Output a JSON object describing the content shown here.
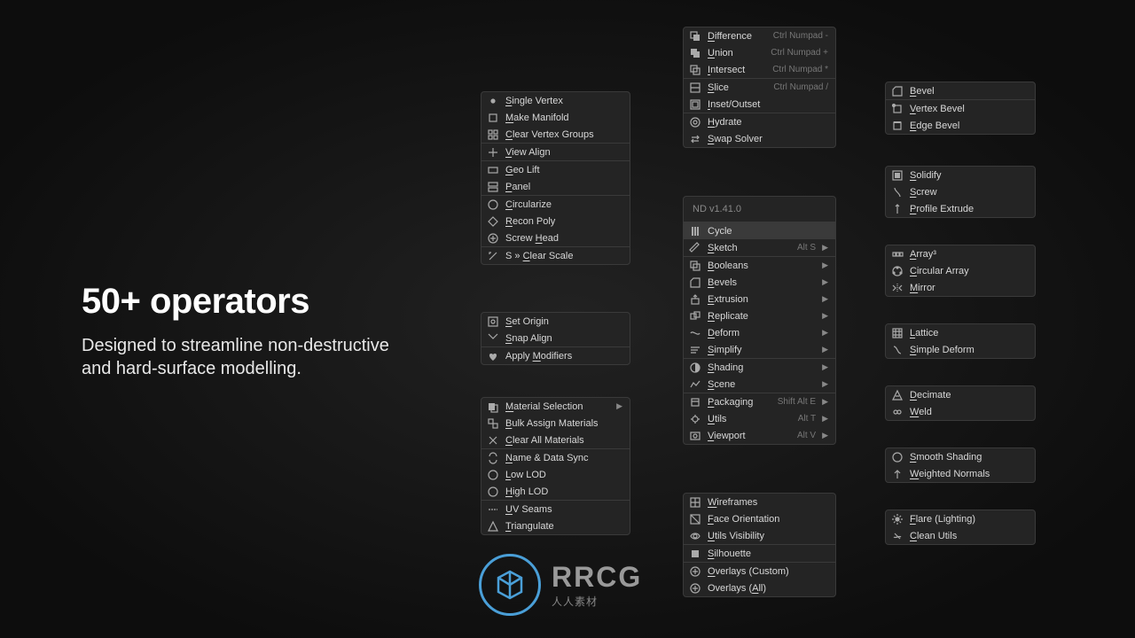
{
  "headline": {
    "title": "50+ operators",
    "subtitle_line1": "Designed to streamline non-destructive",
    "subtitle_line2": "and hard-surface modelling."
  },
  "col1a": [
    {
      "label": "Single Vertex",
      "u": 0,
      "icon": "dot"
    },
    {
      "label": "Make Manifold",
      "u": 0,
      "icon": "box"
    },
    {
      "label": "Clear Vertex Groups",
      "u": 0,
      "icon": "grid"
    },
    {
      "sep": true
    },
    {
      "label": "View Align",
      "u": 0,
      "icon": "align"
    },
    {
      "sep": true
    },
    {
      "label": "Geo Lift",
      "u": 0,
      "icon": "rect"
    },
    {
      "label": "Panel",
      "u": 0,
      "icon": "panel"
    },
    {
      "sep": true
    },
    {
      "label": "Circularize",
      "u": 0,
      "icon": "circle"
    },
    {
      "label": "Recon Poly",
      "u": 0,
      "icon": "shape"
    },
    {
      "label": "Screw Head",
      "u": 6,
      "icon": "screwhead"
    },
    {
      "sep": true
    },
    {
      "label": "S » Clear Scale",
      "u": 4,
      "icon": "clears"
    }
  ],
  "col1b": [
    {
      "label": "Set Origin",
      "u": 0,
      "icon": "origin"
    },
    {
      "label": "Snap Align",
      "u": 0,
      "icon": "snap"
    },
    {
      "sep": true
    },
    {
      "label": "Apply Modifiers",
      "u": 6,
      "icon": "heart"
    }
  ],
  "col1c": [
    {
      "label": "Material Selection",
      "u": 0,
      "icon": "mat",
      "arrow": true
    },
    {
      "label": "Bulk Assign Materials",
      "u": 0,
      "icon": "bulk"
    },
    {
      "label": "Clear All Materials",
      "u": 0,
      "icon": "clear"
    },
    {
      "sep": true
    },
    {
      "label": "Name & Data Sync",
      "u": 0,
      "icon": "sync"
    },
    {
      "label": "Low LOD",
      "u": 0,
      "icon": "circle"
    },
    {
      "label": "High LOD",
      "u": 0,
      "icon": "circle"
    },
    {
      "sep": true
    },
    {
      "label": "UV Seams",
      "u": 0,
      "icon": "seam"
    },
    {
      "label": "Triangulate",
      "u": 0,
      "icon": "tri"
    }
  ],
  "col2a": [
    {
      "label": "Difference",
      "u": 0,
      "icon": "diff",
      "shortcut": "Ctrl Numpad -"
    },
    {
      "label": "Union",
      "u": 0,
      "icon": "union",
      "shortcut": "Ctrl Numpad +"
    },
    {
      "label": "Intersect",
      "u": 0,
      "icon": "intersect",
      "shortcut": "Ctrl Numpad *"
    },
    {
      "sep": true
    },
    {
      "label": "Slice",
      "u": 0,
      "icon": "slice",
      "shortcut": "Ctrl Numpad /"
    },
    {
      "label": "Inset/Outset",
      "u": 0,
      "icon": "inset"
    },
    {
      "sep": true
    },
    {
      "label": "Hydrate",
      "u": 0,
      "icon": "hydrate"
    },
    {
      "label": "Swap Solver",
      "u": 0,
      "icon": "swap"
    }
  ],
  "col2b_header": "ND v1.41.0",
  "col2b": [
    {
      "label": "Cycle",
      "icon": "cycle",
      "highlight": true
    },
    {
      "label": "Sketch",
      "u": 0,
      "icon": "sketch",
      "shortcut": "Alt S",
      "arrow": true
    },
    {
      "sep": true
    },
    {
      "label": "Booleans",
      "u": 0,
      "icon": "bool",
      "arrow": true
    },
    {
      "label": "Bevels",
      "u": 0,
      "icon": "bevel",
      "arrow": true
    },
    {
      "label": "Extrusion",
      "u": 0,
      "icon": "extrude",
      "arrow": true
    },
    {
      "label": "Replicate",
      "u": 0,
      "icon": "replicate",
      "arrow": true
    },
    {
      "label": "Deform",
      "u": 0,
      "icon": "deform",
      "arrow": true
    },
    {
      "label": "Simplify",
      "u": 0,
      "icon": "simplify",
      "arrow": true
    },
    {
      "sep": true
    },
    {
      "label": "Shading",
      "u": 0,
      "icon": "shading",
      "arrow": true
    },
    {
      "label": "Scene",
      "u": 0,
      "icon": "scene",
      "arrow": true
    },
    {
      "sep": true
    },
    {
      "label": "Packaging",
      "u": 0,
      "icon": "pack",
      "shortcut": "Shift Alt E",
      "arrow": true
    },
    {
      "label": "Utils",
      "u": 0,
      "icon": "utils",
      "shortcut": "Alt T",
      "arrow": true
    },
    {
      "label": "Viewport",
      "u": 0,
      "icon": "viewport",
      "shortcut": "Alt V",
      "arrow": true
    }
  ],
  "col2c": [
    {
      "label": "Wireframes",
      "u": 0,
      "icon": "wire"
    },
    {
      "label": "Face Orientation",
      "u": 0,
      "icon": "face"
    },
    {
      "label": "Utils Visibility",
      "u": 0,
      "icon": "vis"
    },
    {
      "sep": true
    },
    {
      "label": "Silhouette",
      "u": 0,
      "icon": "sil"
    },
    {
      "sep": true
    },
    {
      "label": "Overlays (Custom)",
      "u": 0,
      "icon": "over"
    },
    {
      "label": "Overlays (All)",
      "u": 10,
      "icon": "over"
    }
  ],
  "col3a": [
    {
      "label": "Bevel",
      "u": 0,
      "icon": "bevel"
    },
    {
      "sep": true
    },
    {
      "label": "Vertex Bevel",
      "u": 0,
      "icon": "vbev"
    },
    {
      "label": "Edge Bevel",
      "u": 0,
      "icon": "ebev"
    }
  ],
  "col3b": [
    {
      "label": "Solidify",
      "u": 0,
      "icon": "sol"
    },
    {
      "label": "Screw",
      "u": 0,
      "icon": "screw"
    },
    {
      "label": "Profile Extrude",
      "u": 0,
      "icon": "pext"
    }
  ],
  "col3c": [
    {
      "label": "Array³",
      "u": 0,
      "icon": "arr"
    },
    {
      "label": "Circular Array",
      "u": 0,
      "icon": "carr"
    },
    {
      "label": "Mirror",
      "u": 0,
      "icon": "mirr"
    }
  ],
  "col3d": [
    {
      "label": "Lattice",
      "u": 0,
      "icon": "lat"
    },
    {
      "label": "Simple Deform",
      "u": 0,
      "icon": "sdef"
    }
  ],
  "col3e": [
    {
      "label": "Decimate",
      "u": 0,
      "icon": "dec"
    },
    {
      "label": "Weld",
      "u": 0,
      "icon": "weld"
    }
  ],
  "col3f": [
    {
      "label": "Smooth Shading",
      "u": 0,
      "icon": "smooth"
    },
    {
      "label": "Weighted Normals",
      "u": 0,
      "icon": "wn"
    }
  ],
  "col3g": [
    {
      "label": "Flare (Lighting)",
      "u": 0,
      "icon": "flare"
    },
    {
      "label": "Clean Utils",
      "u": 0,
      "icon": "clean"
    }
  ],
  "logo": {
    "main": "RRCG",
    "sub": "人人素材"
  }
}
